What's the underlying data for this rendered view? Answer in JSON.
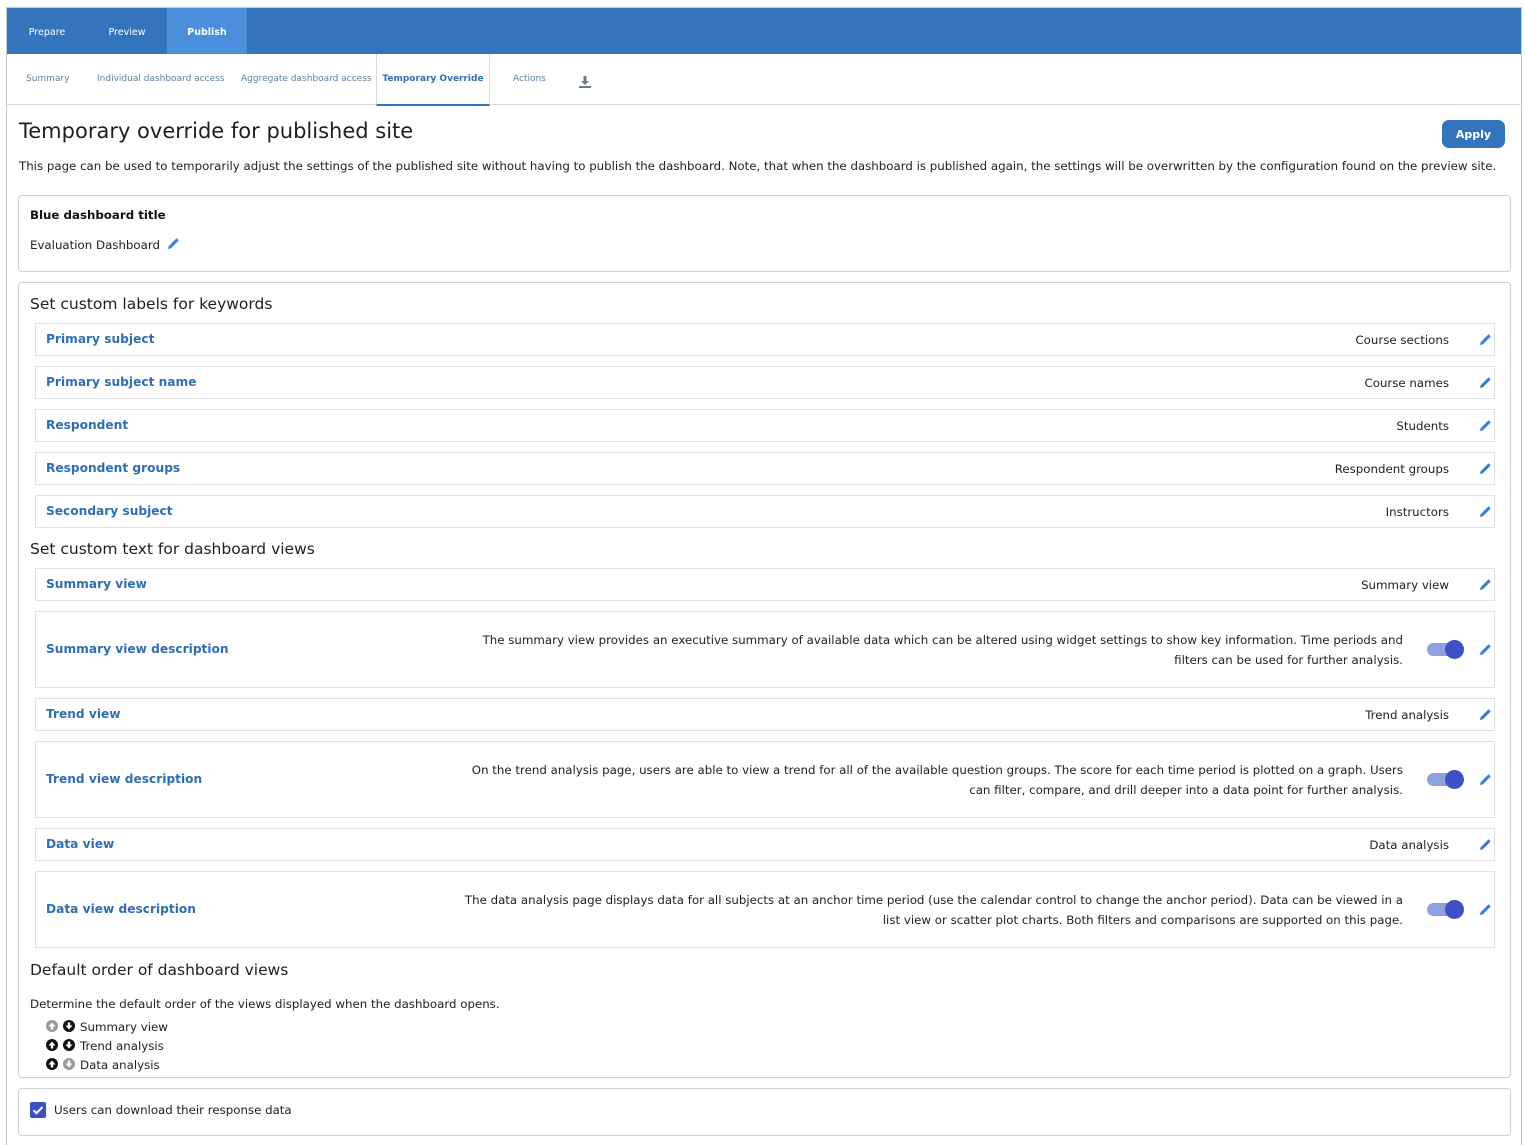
{
  "topnav": {
    "tabs": [
      {
        "label": "Prepare"
      },
      {
        "label": "Preview"
      },
      {
        "label": "Publish"
      }
    ]
  },
  "subnav": {
    "tabs": [
      {
        "label": "Summary"
      },
      {
        "label": "Individual dashboard access"
      },
      {
        "label": "Aggregate dashboard access"
      },
      {
        "label": "Temporary Override"
      },
      {
        "label": "Actions"
      }
    ],
    "download_icon": "download-icon"
  },
  "page": {
    "title": "Temporary override for published site",
    "apply_label": "Apply",
    "intro": "This page can be used to temporarily adjust the settings of the published site without having to publish the dashboard. Note, that when the dashboard is published again, the settings will be overwritten by the configuration found on the preview site."
  },
  "title_card": {
    "label": "Blue dashboard title",
    "value": "Evaluation Dashboard"
  },
  "keywords": {
    "heading": "Set custom labels for keywords",
    "rows": [
      {
        "label": "Primary subject",
        "value": "Course sections"
      },
      {
        "label": "Primary subject name",
        "value": "Course names"
      },
      {
        "label": "Respondent",
        "value": "Students"
      },
      {
        "label": "Respondent groups",
        "value": "Respondent groups"
      },
      {
        "label": "Secondary subject",
        "value": "Instructors"
      }
    ]
  },
  "views": {
    "heading": "Set custom text for dashboard views",
    "summary_view": {
      "label": "Summary view",
      "value": "Summary view"
    },
    "summary_desc": {
      "label": "Summary view description",
      "line1": "The summary view provides an executive summary of available data which can be altered using widget settings to show key information. Time periods and",
      "line2": "filters can be used for further analysis.",
      "toggle_on": true
    },
    "trend_view": {
      "label": "Trend view",
      "value": "Trend analysis"
    },
    "trend_desc": {
      "label": "Trend view description",
      "line1": "On the trend analysis page, users are able to view a trend for all of the available question groups. The score for each time period is plotted on a graph. Users",
      "line2": "can filter, compare, and drill deeper into a data point for further analysis.",
      "toggle_on": true
    },
    "data_view": {
      "label": "Data view",
      "value": "Data analysis"
    },
    "data_desc": {
      "label": "Data view description",
      "line1": "The data analysis page displays data for all subjects at an anchor time period (use the calendar control to change the anchor period). Data can be viewed in a",
      "line2": "list view or scatter plot charts. Both filters and comparisons are supported on this page.",
      "toggle_on": true
    }
  },
  "order": {
    "heading": "Default order of dashboard views",
    "desc": "Determine the default order of the views displayed when the dashboard opens.",
    "items": [
      {
        "label": "Summary view"
      },
      {
        "label": "Trend analysis"
      },
      {
        "label": "Data analysis"
      }
    ]
  },
  "download": {
    "label": "Users can download their response data",
    "checked": true
  },
  "colors": {
    "nav": "#3474bd",
    "nav_active": "#4a8fdc",
    "link": "#2e6fb3",
    "toggle": "#3d50c6"
  }
}
